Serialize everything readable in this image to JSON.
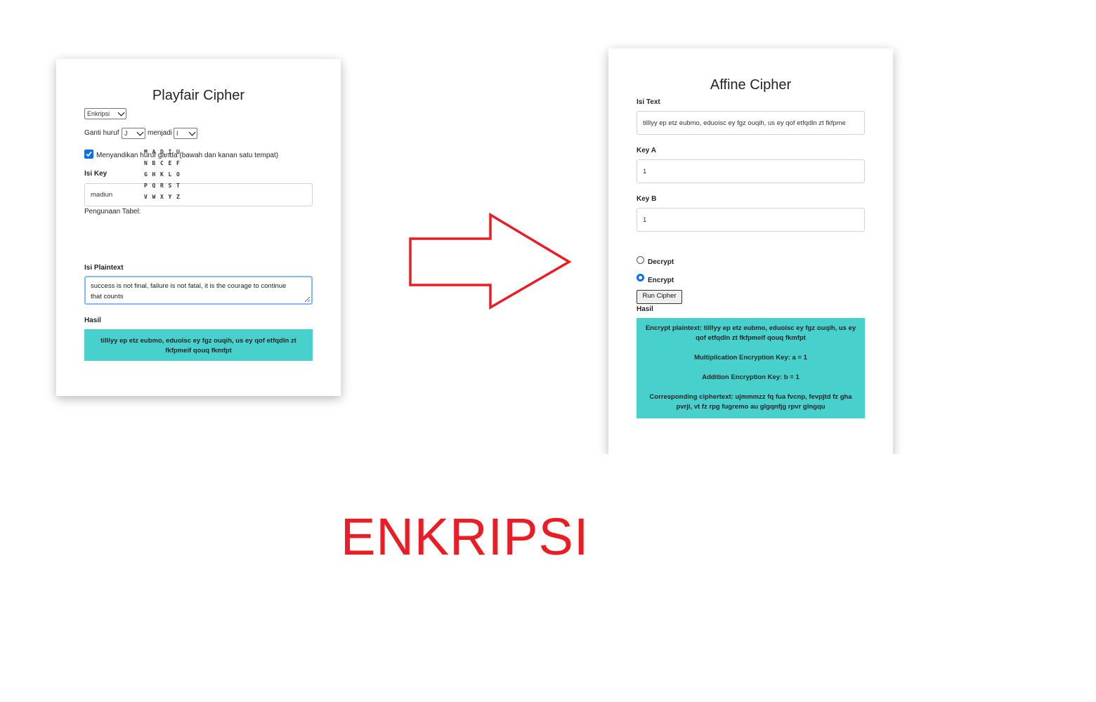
{
  "playfair": {
    "title": "Playfair Cipher",
    "mode_select": "Enkripsi",
    "replace_label": "Ganti huruf",
    "replace_from": "J",
    "replace_to_label": "menjadi",
    "replace_to": "I",
    "double_letter_checked": true,
    "double_letter_label": "Menyandikan huruf ganda (bawah dan kanan satu tempat)",
    "key_label": "Isi Key",
    "key_value": "madiun",
    "table_label": "Pengunaan Tabel:",
    "table": [
      [
        "M",
        "A",
        "D",
        "I",
        "U"
      ],
      [
        "N",
        "B",
        "C",
        "E",
        "F"
      ],
      [
        "G",
        "H",
        "K",
        "L",
        "O"
      ],
      [
        "P",
        "Q",
        "R",
        "S",
        "T"
      ],
      [
        "V",
        "W",
        "X",
        "Y",
        "Z"
      ]
    ],
    "plaintext_label": "Isi Plaintext",
    "plaintext_line1": "success is not final, failure is not fatal, it is the courage to continue",
    "plaintext_line2": "that counts",
    "result_label": "Hasil",
    "result_text": "tilllyy ep etz eubmo, eduoisc ey fgz ouqih, us ey qof etfqdln zt fkfpmeif qouq fkmfpt"
  },
  "affine": {
    "title": "Affine Cipher",
    "text_label": "Isi Text",
    "text_value": "tilllyy ep etz eubmo, eduoisc ey fgz ouqih, us ey qof etfqdln zt fkfpme",
    "key_a_label": "Key A",
    "key_a_value": "1",
    "key_b_label": "Key B",
    "key_b_value": "1",
    "decrypt_label": "Decrypt",
    "encrypt_label": "Encrypt",
    "selected_mode": "Encrypt",
    "run_button": "Run Cipher",
    "result_label": "Hasil",
    "result_line1": "Encrypt plaintext: tilllyy ep etz eubmo, eduoisc ey fgz ouqih, us ey qof etfqdln zt fkfpmeif qouq fkmfpt",
    "result_line2": "Multiplication Encryption Key: a = 1",
    "result_line3": "Addition Encryption Key: b = 1",
    "result_line4": "Corresponding ciphertext: ujmmmzz fq fua fvcnp, fevpjtd fz gha pvrji, vt fz rpg fugremo au glgqnfjg rpvr glngqu"
  },
  "annotation": {
    "label": "ENKRIPSI",
    "arrow_icon": "right-arrow-icon",
    "color": "#ea1c24"
  }
}
